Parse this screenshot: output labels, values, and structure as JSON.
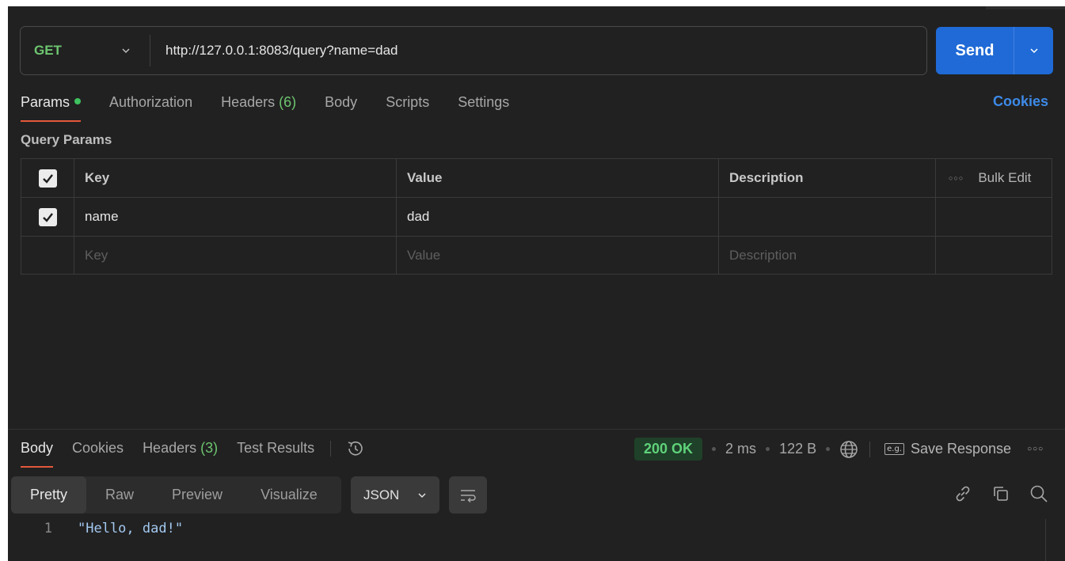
{
  "request": {
    "method": "GET",
    "url": "http://127.0.0.1:8083/query?name=dad",
    "send_label": "Send"
  },
  "request_tabs": [
    {
      "label": "Params",
      "active": true
    },
    {
      "label": "Authorization"
    },
    {
      "label": "Headers",
      "count": "(6)"
    },
    {
      "label": "Body"
    },
    {
      "label": "Scripts"
    },
    {
      "label": "Settings"
    }
  ],
  "cookies_link": "Cookies",
  "query_params": {
    "title": "Query Params",
    "headers": {
      "key": "Key",
      "value": "Value",
      "description": "Description",
      "bulk_edit": "Bulk Edit"
    },
    "rows": [
      {
        "key": "name",
        "value": "dad",
        "description": "",
        "checked": true
      }
    ],
    "placeholder": {
      "key": "Key",
      "value": "Value",
      "description": "Description"
    }
  },
  "response_tabs": [
    {
      "label": "Body",
      "active": true
    },
    {
      "label": "Cookies"
    },
    {
      "label": "Headers",
      "count": "(3)"
    },
    {
      "label": "Test Results"
    }
  ],
  "response_meta": {
    "status": "200 OK",
    "time": "2 ms",
    "size": "122 B",
    "save_label": "Save Response",
    "save_badge": "e.g."
  },
  "view_modes": [
    "Pretty",
    "Raw",
    "Preview",
    "Visualize"
  ],
  "active_view": "Pretty",
  "format": "JSON",
  "code": {
    "line": "1",
    "text": "\"Hello, dad!\""
  },
  "colors": {
    "send": "#1f6ad6",
    "method": "#6dc56f",
    "status_ok": "#5fd27a",
    "accent": "#e4583a",
    "link": "#3d8ae8"
  }
}
